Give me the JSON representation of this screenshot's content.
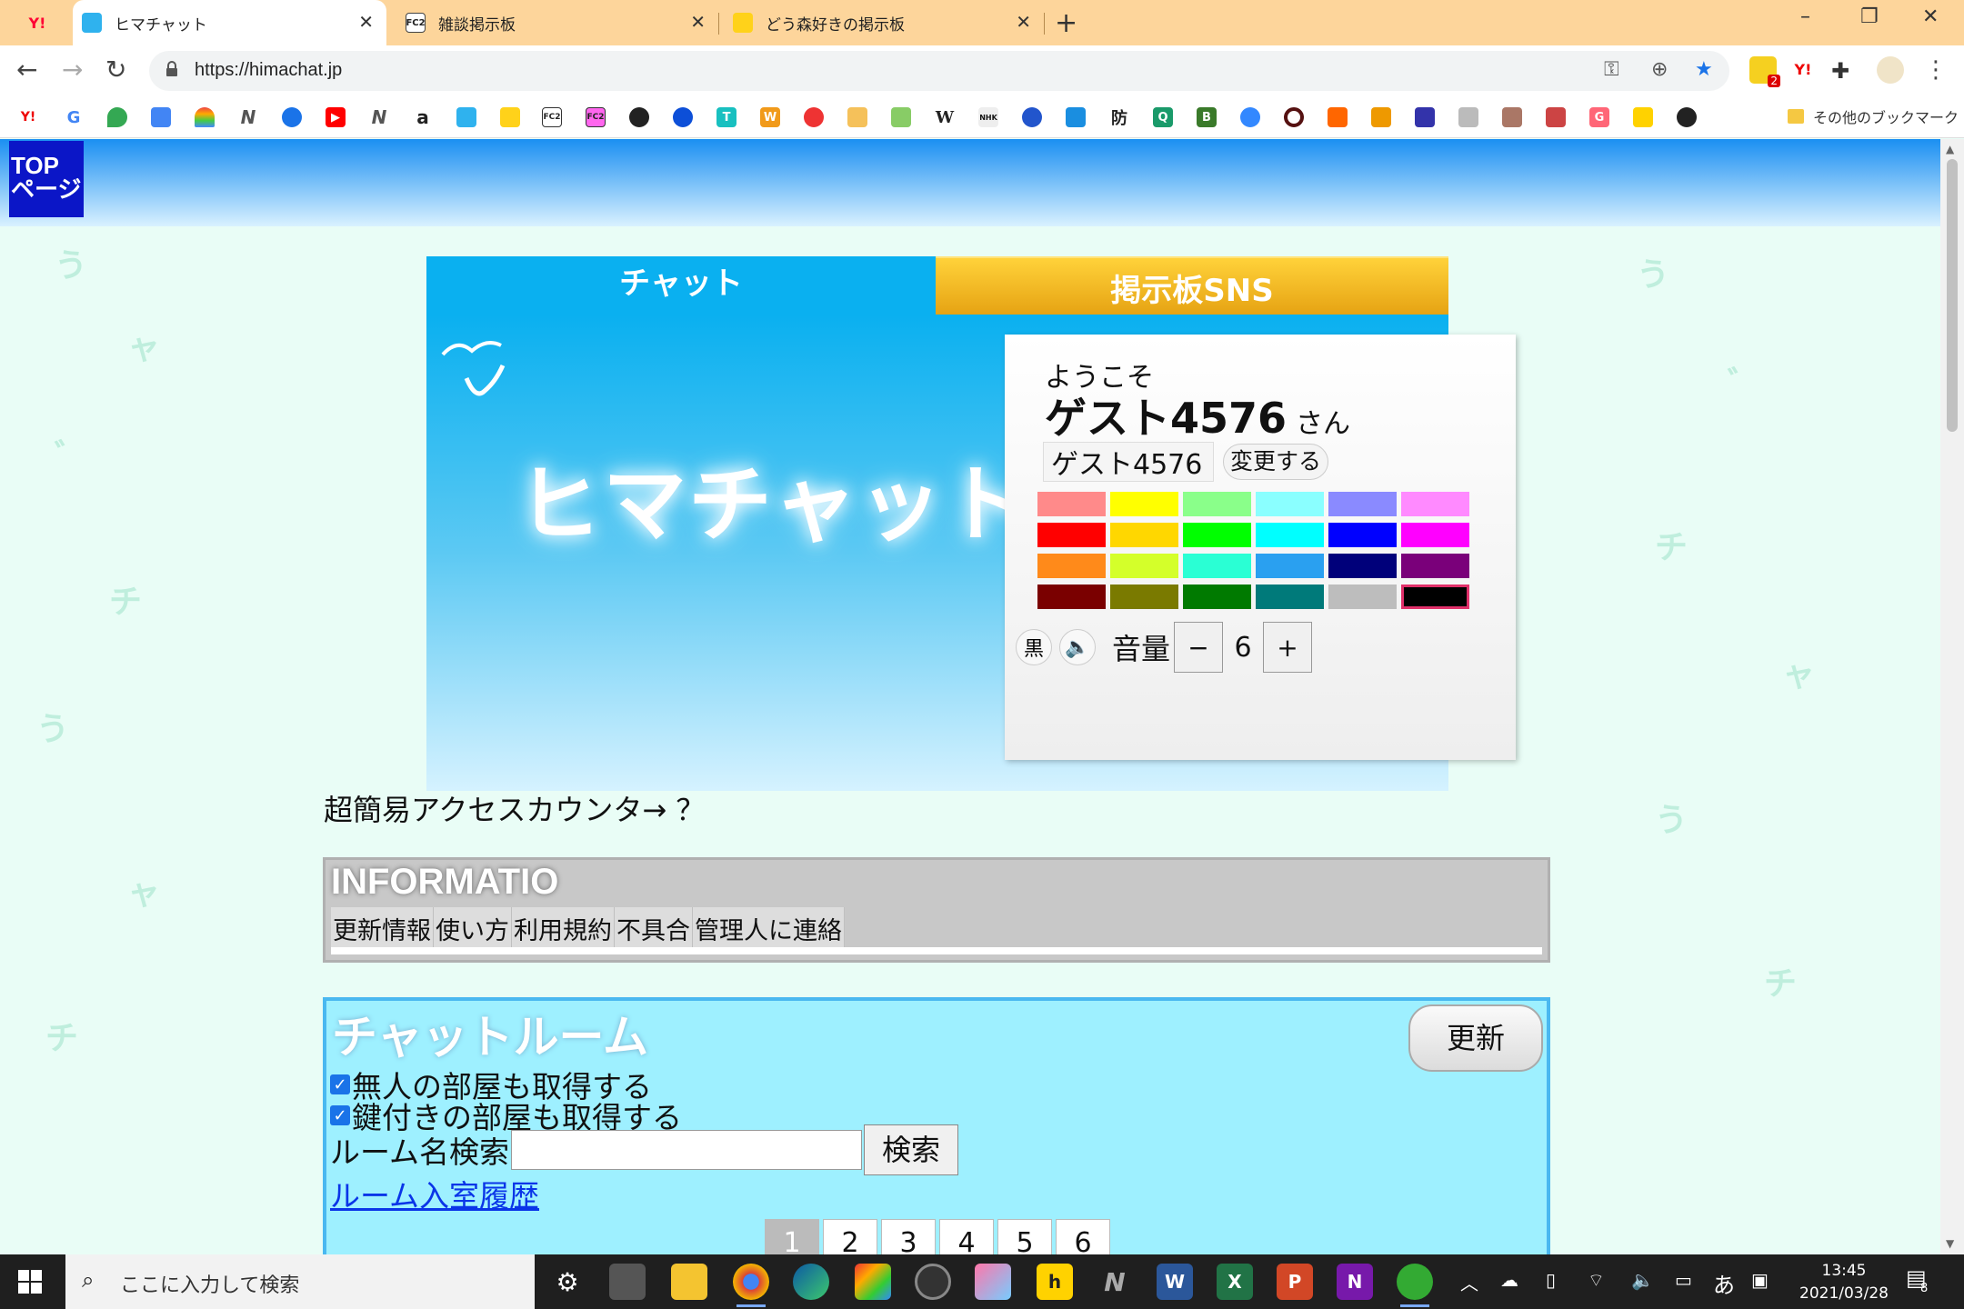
{
  "browser": {
    "tabs": [
      {
        "label": "",
        "favicon": "yahoo-icon"
      },
      {
        "label": "ヒマチャット",
        "favicon": "himachat-icon"
      },
      {
        "label": "雑談掲示板",
        "favicon": "fc2-icon"
      },
      {
        "label": "どう森好きの掲示板",
        "favicon": "pikachu-icon"
      }
    ],
    "url": "https://himachat.jp",
    "ext_badge": "2",
    "other_bookmarks": "その他のブックマーク",
    "bookmarks": [
      "Y!",
      "G",
      "",
      "",
      "",
      "N",
      "",
      "",
      "N",
      "a",
      "",
      "",
      "FC2",
      "FC2",
      "",
      "",
      "T",
      "W",
      "",
      "",
      "",
      "W",
      "NHK",
      "",
      "",
      "防",
      "Q",
      "B",
      "",
      "",
      "",
      "",
      "",
      "",
      "",
      "",
      "G",
      "",
      ""
    ]
  },
  "page": {
    "top_button": "TOP\nページ",
    "tabs": {
      "chat": "チャット",
      "sns": "掲示板SNS"
    },
    "hero_title": "ヒマチャット",
    "welcome": {
      "greeting": "ようこそ",
      "name": "ゲスト4576",
      "suffix": "さん",
      "name_input": "ゲスト4576",
      "change_button": "変更する",
      "palette": [
        "#ff8a8a",
        "#ffff00",
        "#8aff8a",
        "#8affff",
        "#8a8aff",
        "#ff8aff",
        "#ff0000",
        "#ffd700",
        "#00ff00",
        "#00ffff",
        "#0000ff",
        "#ff00ff",
        "#ff8a1a",
        "#d4ff2a",
        "#2affd4",
        "#2aa0f0",
        "#00007a",
        "#7a007a",
        "#7a0000",
        "#7a7a00",
        "#007a00",
        "#007a7a",
        "#bdbdbd",
        "#000000"
      ],
      "selected_color": "#000000",
      "color_mode_label": "黒",
      "volume_label": "音量",
      "volume_minus": "−",
      "volume_value": "6",
      "volume_plus": "+"
    },
    "counter_text": "超簡易アクセスカウンタ→ ？",
    "info": {
      "title": "INFORMATIO",
      "links": [
        "更新情報",
        "使い方",
        "利用規約",
        "不具合",
        "管理人に連絡"
      ]
    },
    "rooms": {
      "title": "チャットルーム",
      "refresh": "更新",
      "check_empty": "無人の部屋も取得する",
      "check_locked": "鍵付きの部屋も取得する",
      "search_label": "ルーム名検索",
      "search_value": "",
      "search_button": "検索",
      "history_link": "ルーム入室履歴",
      "pages": [
        "1",
        "2",
        "3",
        "4",
        "5",
        "6"
      ],
      "current_page": "1"
    }
  },
  "taskbar": {
    "search_placeholder": "ここに入力して検索",
    "ime": "あ",
    "time": "13:45",
    "date": "2021/03/28",
    "notifications": "8"
  }
}
